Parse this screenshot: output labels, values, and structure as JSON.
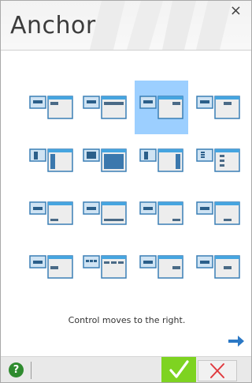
{
  "dialog": {
    "title": "Anchor",
    "close_glyph": "×"
  },
  "options": [
    {
      "name": "anchor-option-1",
      "selected": false
    },
    {
      "name": "anchor-option-2",
      "selected": false
    },
    {
      "name": "anchor-option-3",
      "selected": true
    },
    {
      "name": "anchor-option-4",
      "selected": false
    },
    {
      "name": "anchor-option-5",
      "selected": false
    },
    {
      "name": "anchor-option-6",
      "selected": false
    },
    {
      "name": "anchor-option-7",
      "selected": false
    },
    {
      "name": "anchor-option-8",
      "selected": false
    },
    {
      "name": "anchor-option-9",
      "selected": false
    },
    {
      "name": "anchor-option-10",
      "selected": false
    },
    {
      "name": "anchor-option-11",
      "selected": false
    },
    {
      "name": "anchor-option-12",
      "selected": false
    },
    {
      "name": "anchor-option-13",
      "selected": false
    },
    {
      "name": "anchor-option-14",
      "selected": false
    },
    {
      "name": "anchor-option-15",
      "selected": false
    },
    {
      "name": "anchor-option-16",
      "selected": false
    }
  ],
  "status_text": "Control moves to the right.",
  "footer": {
    "help_label": "?",
    "ok_icon": "check-icon",
    "cancel_icon": "x-icon"
  },
  "colors": {
    "selection": "#9ccfff",
    "accent_green": "#7ed321",
    "help_green": "#2f8b2f",
    "cancel_red": "#e0393e",
    "arrow_blue": "#2b78c5"
  }
}
